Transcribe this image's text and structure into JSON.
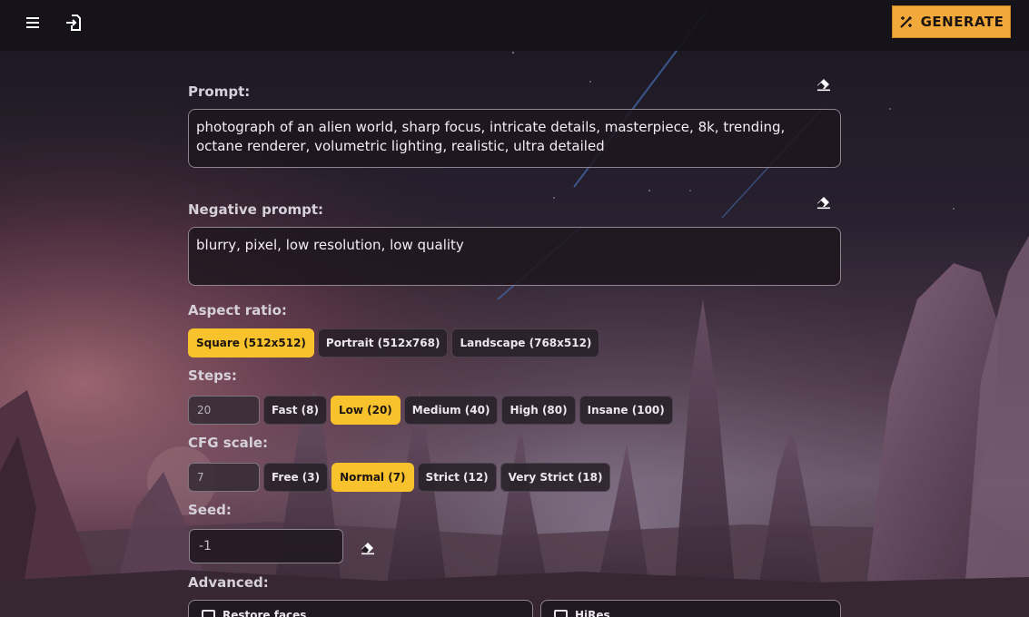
{
  "header": {
    "menu_icon": "hamburger-icon",
    "login_icon": "login-icon",
    "generate_label": "GENERATE",
    "generate_icon": "magic-wand-icon",
    "generate_color": "#f2a93b"
  },
  "prompt": {
    "label": "Prompt:",
    "value": "photograph of an alien world, sharp focus, intricate details, masterpiece, 8k, trending, octane renderer, volumetric lighting, realistic, ultra detailed",
    "clear_icon": "eraser-icon"
  },
  "negative_prompt": {
    "label": "Negative prompt:",
    "value": "blurry, pixel, low resolution, low quality",
    "clear_icon": "eraser-icon"
  },
  "aspect_ratio": {
    "label": "Aspect ratio:",
    "options": [
      {
        "label": "Square (512x512)",
        "active": true
      },
      {
        "label": "Portrait (512x768)",
        "active": false
      },
      {
        "label": "Landscape (768x512)",
        "active": false
      }
    ]
  },
  "steps": {
    "label": "Steps:",
    "value": "20",
    "options": [
      {
        "label": "Fast (8)",
        "active": false
      },
      {
        "label": "Low (20)",
        "active": true
      },
      {
        "label": "Medium (40)",
        "active": false
      },
      {
        "label": "High (80)",
        "active": false
      },
      {
        "label": "Insane (100)",
        "active": false
      }
    ]
  },
  "cfg_scale": {
    "label": "CFG scale:",
    "value": "7",
    "options": [
      {
        "label": "Free (3)",
        "active": false
      },
      {
        "label": "Normal (7)",
        "active": true
      },
      {
        "label": "Strict (12)",
        "active": false
      },
      {
        "label": "Very Strict (18)",
        "active": false
      }
    ]
  },
  "seed": {
    "label": "Seed:",
    "value": "-1",
    "clear_icon": "eraser-icon"
  },
  "advanced": {
    "label": "Advanced:",
    "options": [
      {
        "label": "Restore faces",
        "checked": false
      },
      {
        "label": "HiRes",
        "checked": false
      }
    ]
  },
  "colors": {
    "accent": "#f8c22c",
    "panel": "#2a2230",
    "topbar": "#161218"
  }
}
